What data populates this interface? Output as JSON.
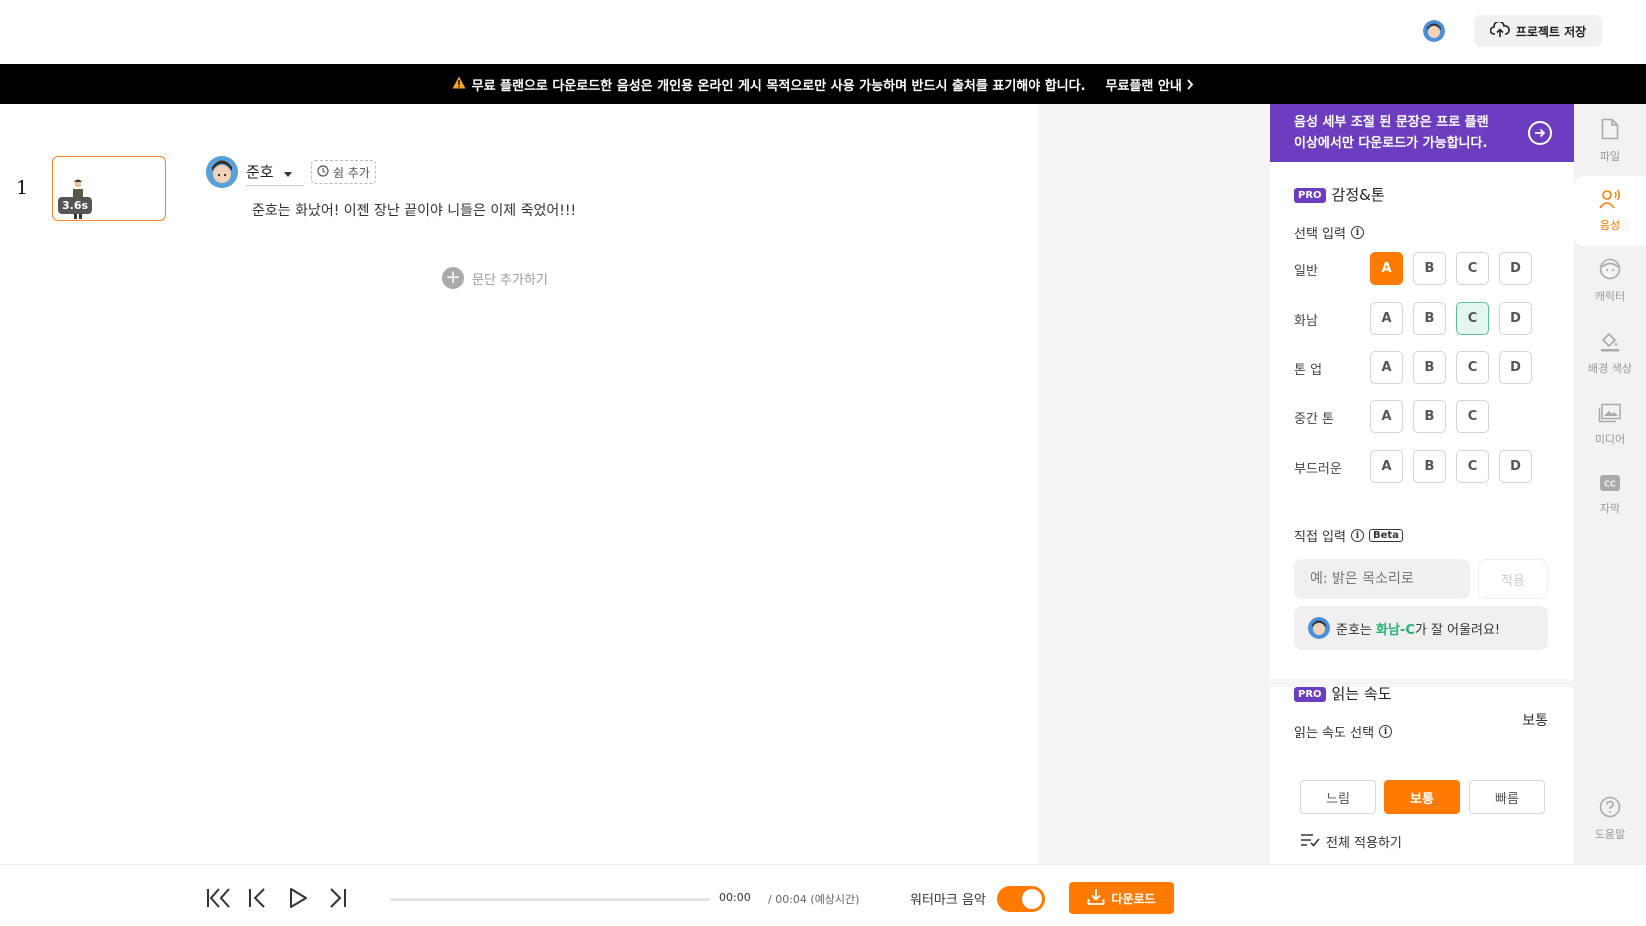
{
  "header": {
    "save_label": "프로젝트 저장"
  },
  "notice": {
    "text": "무료 플랜으로 다운로드한 음성은 개인용 온라인 게시 목적으로만 사용 가능하며 반드시 출처를 표기해야 합니다.",
    "link_label": "무료플랜 안내"
  },
  "editor": {
    "row_number": "1",
    "clip_duration": "3.6s",
    "character_name": "준호",
    "rest_label": "쉼 추가",
    "script_text": "준호는 화났어! 이젠 장난 끝이야 니들은 이제 죽었어!!!",
    "add_paragraph_label": "문단 추가하기"
  },
  "panel": {
    "pro_banner_line1": "음성 세부 조절 된 문장은 프로 플랜",
    "pro_banner_line2": "이상에서만 다운로드가 가능합니다.",
    "pro_badge": "PRO",
    "emotion_title": "감정&톤",
    "select_input_label": "선택 입력",
    "tones": [
      {
        "label": "일반",
        "options": [
          "A",
          "B",
          "C",
          "D"
        ]
      },
      {
        "label": "화남",
        "options": [
          "A",
          "B",
          "C",
          "D"
        ]
      },
      {
        "label": "톤 업",
        "options": [
          "A",
          "B",
          "C",
          "D"
        ]
      },
      {
        "label": "중간 톤",
        "options": [
          "A",
          "B",
          "C"
        ]
      },
      {
        "label": "부드러운",
        "options": [
          "A",
          "B",
          "C",
          "D"
        ]
      }
    ],
    "selected_tone": "일반-A",
    "recommended_tone": "화남-C",
    "direct_input_label": "직접 입력",
    "beta_label": "Beta",
    "direct_input_placeholder": "예: 밝은 목소리로",
    "apply_label": "적용",
    "recommend_prefix": "준호는 ",
    "recommend_highlight": "화남-C",
    "recommend_suffix": "가 잘 어울려요!",
    "speed_title": "읽는 속도",
    "speed_value": "보통",
    "speed_select_label": "읽는 속도 선택",
    "speed_options": [
      "느림",
      "보통",
      "빠름"
    ],
    "apply_all_label": "전체 적용하기"
  },
  "sidebar": {
    "items": [
      {
        "label": "파일",
        "icon": "file-icon"
      },
      {
        "label": "음성",
        "icon": "voice-icon",
        "active": true
      },
      {
        "label": "캐릭터",
        "icon": "character-icon"
      },
      {
        "label": "배경 색상",
        "icon": "paint-bucket-icon"
      },
      {
        "label": "미디어",
        "icon": "media-icon"
      },
      {
        "label": "자막",
        "icon": "caption-icon"
      }
    ],
    "help_label": "도움말"
  },
  "player": {
    "current_time": "00:00",
    "total_time": "/ 00:04 (예상시간)",
    "watermark_label": "워터마크 음악",
    "watermark_on": true,
    "download_label": "다운로드"
  },
  "colors": {
    "accent": "#ff7a00",
    "pro_purple": "#6c3ebf",
    "recommend_green": "#21b36f"
  }
}
